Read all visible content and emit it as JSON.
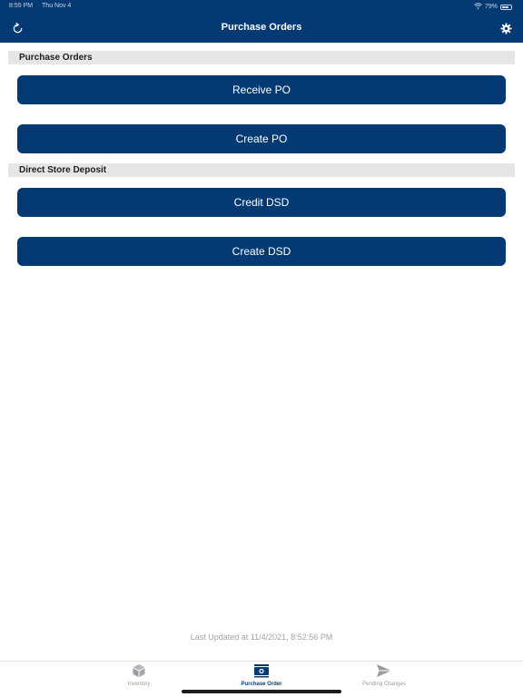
{
  "status_bar": {
    "time": "8:55 PM",
    "date": "Thu Nov 4",
    "battery_percent": "79%",
    "battery_level": 0.79,
    "wifi_icon": "wifi-icon",
    "battery_icon": "battery-icon"
  },
  "nav": {
    "title": "Purchase Orders",
    "refresh_icon": "refresh-icon",
    "settings_icon": "gear-icon"
  },
  "sections": {
    "purchase_orders": {
      "title": "Purchase Orders",
      "buttons": [
        "Receive PO",
        "Create PO"
      ]
    },
    "dsd": {
      "title": "Direct Store Deposit",
      "buttons": [
        "Credit DSD",
        "Create DSD"
      ]
    }
  },
  "footer": {
    "last_updated": "Last Updated at 11/4/2021, 8:52:56 PM"
  },
  "tabs": [
    {
      "label": "Inventory",
      "icon": "box-icon",
      "active": false
    },
    {
      "label": "Purchase Order",
      "icon": "money-icon",
      "active": true
    },
    {
      "label": "Pending Changes",
      "icon": "send-icon",
      "active": false
    }
  ],
  "colors": {
    "primary": "#033a73",
    "section_bg": "#e6e6e8",
    "inactive_tab": "#9a9aa0"
  }
}
